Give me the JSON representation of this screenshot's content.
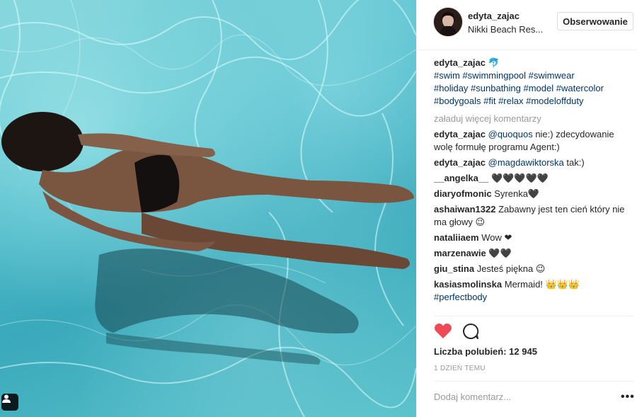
{
  "post": {
    "username": "edyta_zajac",
    "location": "Nikki Beach Res...",
    "follow_label": "Obserwowanie",
    "caption_user": "edyta_zajac",
    "caption_emoji": "🐬",
    "hashtags_line1": "#swim #swimmingpool #swimwear",
    "hashtags_line2": "#holiday #sunbathing #model #watercolor",
    "hashtags_line3": "#bodygoals #fit #relax #modeloffduty",
    "load_more": "załaduj więcej komentarzy",
    "likes": "Liczba polubień: 12 945",
    "time": "1 DZIEŃ TEMU",
    "add_comment_placeholder": "Dodaj komentarz...",
    "more_icon": "more-options-icon"
  },
  "comments": [
    {
      "user": "edyta_zajac",
      "mention": "@quoquos",
      "text": " nie:) zdecydowanie wolę formułę programu Agent:)"
    },
    {
      "user": "edyta_zajac",
      "mention": "@magdawiktorska",
      "text": " tak:)"
    },
    {
      "user": "__angelka__",
      "mention": "",
      "text": " 🖤🖤🖤🖤🖤"
    },
    {
      "user": "diaryofmonic",
      "mention": "",
      "text": " Syrenka🖤"
    },
    {
      "user": "ashaiwan1322",
      "mention": "",
      "text": " Zabawny jest ten cień który nie ma głowy 😉"
    },
    {
      "user": "nataliiaem",
      "mention": "",
      "text": " Wow ❤"
    },
    {
      "user": "marzenawie",
      "mention": "",
      "text": " 🖤🖤"
    },
    {
      "user": "giu_stina",
      "mention": "",
      "text": " Jesteś piękna 😉"
    },
    {
      "user": "kasiasmolinska",
      "mention": "",
      "text": " Mermaid! 👑👑👑",
      "extra": "#perfectbody"
    }
  ],
  "colors": {
    "heart": "#ed4956",
    "link": "#003569",
    "muted": "#999999"
  }
}
